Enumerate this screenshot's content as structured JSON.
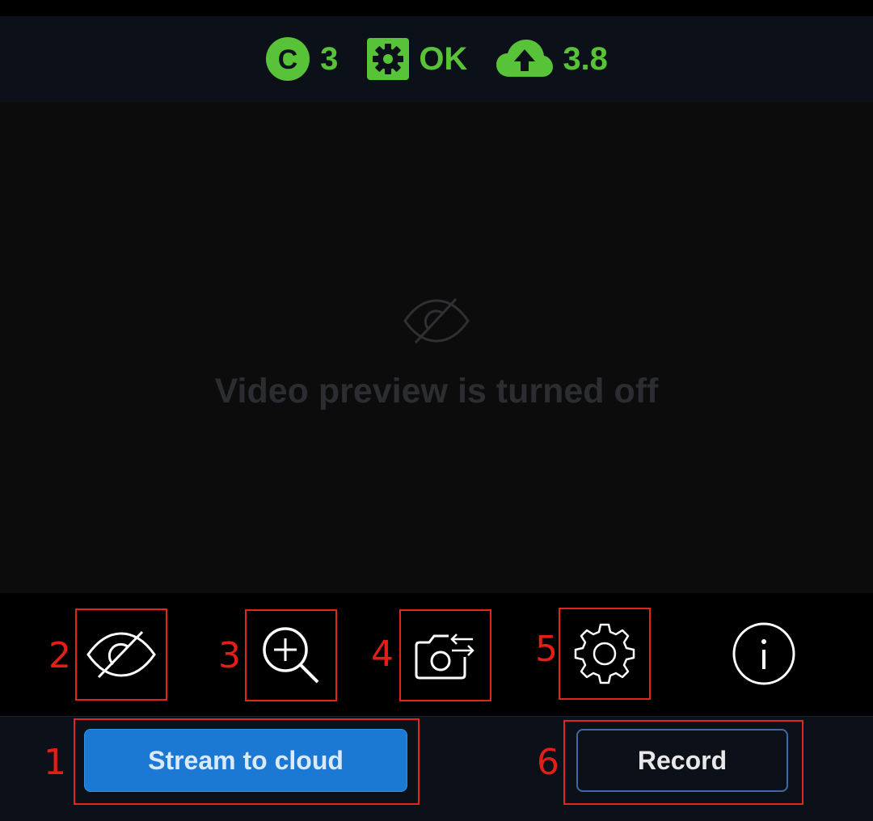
{
  "status": {
    "cameras_count": "3",
    "camera_badge_letter": "C",
    "health": "OK",
    "upload_speed": "3.8",
    "accent_color": "#58c338"
  },
  "preview": {
    "message": "Video preview is turned off",
    "icon": "eye-off-icon"
  },
  "toolbar": {
    "items": [
      {
        "callout": "2",
        "icon": "eye-off-icon"
      },
      {
        "callout": "3",
        "icon": "zoom-in-icon"
      },
      {
        "callout": "4",
        "icon": "switch-camera-icon"
      },
      {
        "callout": "5",
        "icon": "gear-icon"
      },
      {
        "icon": "info-icon"
      }
    ]
  },
  "actions": {
    "stream_callout": "1",
    "stream_label": "Stream to cloud",
    "record_callout": "6",
    "record_label": "Record",
    "stream_color": "#1b79d3"
  }
}
